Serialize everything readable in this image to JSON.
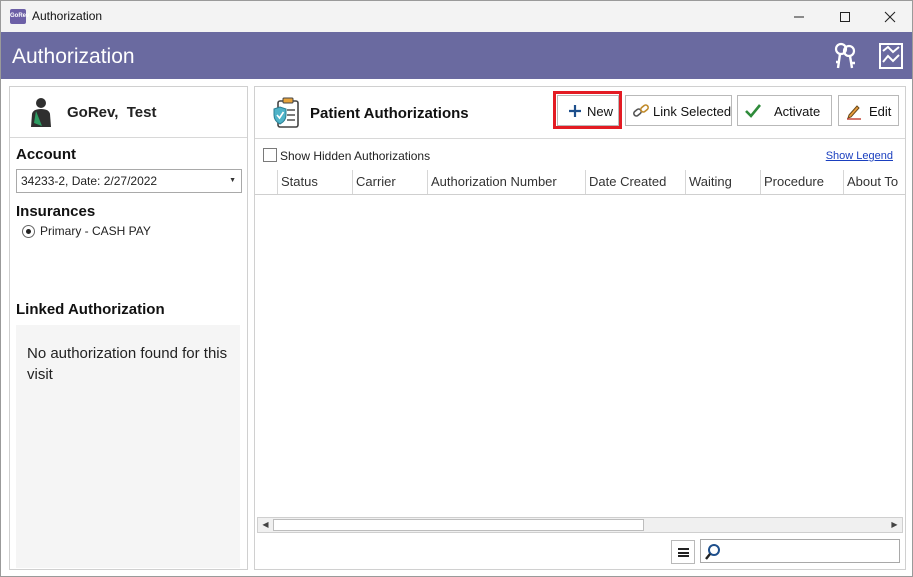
{
  "window": {
    "title": "Authorization",
    "app_icon_text": "GoRev"
  },
  "header": {
    "title": "Authorization",
    "icons": [
      "keys-icon",
      "report-chart-icon"
    ]
  },
  "patient": {
    "name": "GoRev,  Test"
  },
  "account": {
    "label": "Account",
    "selected": "34233-2, Date: 2/27/2022"
  },
  "insurances": {
    "label": "Insurances",
    "items": [
      {
        "label": "Primary - CASH PAY",
        "selected": true
      }
    ]
  },
  "linked": {
    "label": "Linked Authorization",
    "empty_text": "No authorization found for this visit"
  },
  "authorizations": {
    "title": "Patient Authorizations",
    "buttons": {
      "new": "New",
      "link_selected": "Link Selected",
      "activate": "Activate",
      "edit": "Edit"
    },
    "show_hidden_label": "Show Hidden Authorizations",
    "show_hidden_checked": false,
    "legend_link": "Show Legend",
    "columns": [
      "Status",
      "Carrier",
      "Authorization Number",
      "Date Created",
      "Waiting",
      "Procedure",
      "About To"
    ],
    "rows": []
  },
  "colors": {
    "header_bg": "#6a6aa0",
    "highlight": "#e31b23",
    "link": "#1a3fbf"
  }
}
